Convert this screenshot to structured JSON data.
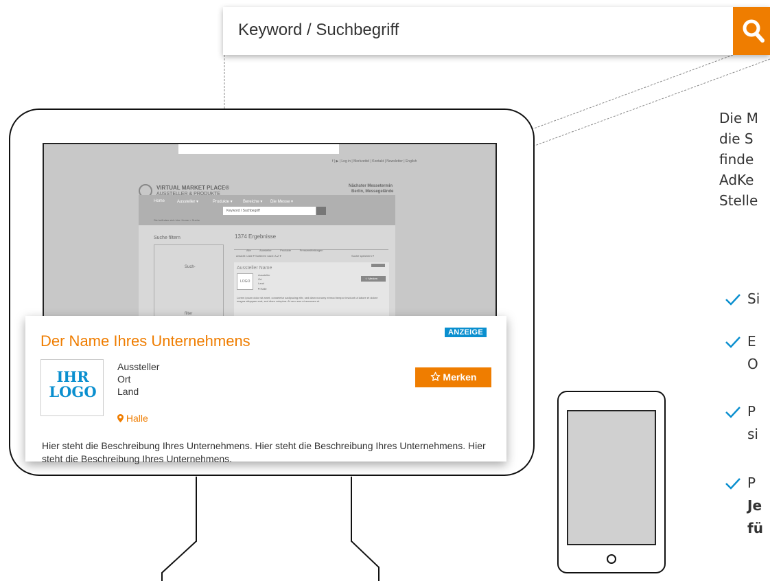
{
  "search": {
    "placeholder": "Keyword / Suchbegriff",
    "icon": "search-icon"
  },
  "mini_site": {
    "title_line1": "VIRTUAL MARKET PLACE®",
    "title_line2": "AUSSTELLER & PRODUKTE",
    "top_links": "f | ▶ | Log in | Merkzettel | Kontakt | Newsletter | English",
    "next_fair": "Nächster Messetermin",
    "next_fair_place": "Berlin, Messegelände",
    "nav": [
      "Home",
      "Aussteller ▾",
      "Produkte ▾",
      "Bereiche ▾",
      "Die Messe ▾"
    ],
    "search_placeholder": "Keyword / Suchbegriff",
    "breadcrumb": "Sie befinden sich hier: Home > Suche",
    "filter_title": "Suche filtern",
    "result_count": "1374 Ergebnisse",
    "tabs": [
      "Alle",
      "Aussteller",
      "Produkte",
      "Pressemitteilungen"
    ],
    "sort": "Ansicht: Liste ▾    Sortieren nach: A-Z ▾",
    "save": "Suche speichern ▾",
    "card_title": "Aussteller Name",
    "card_logo": "LOGO",
    "card_lines": [
      "Aussteller",
      "Ort",
      "Land"
    ],
    "card_merken": "☆ Merken",
    "card_hall": "♥ Halle",
    "card_desc": "Lorem ipsum dolor sit amet, consetetur sadipscing elitr, sed diam nonumy eirmod tempor invidunt ut labore et dolore magna aliquyam erat, sed diam voluptua. At vero eos et accusam et",
    "filter_rows": [
      "Such-",
      "filter"
    ]
  },
  "ad": {
    "company_name": "Der Name Ihres Unternehmens",
    "badge": "ANZEIGE",
    "logo": [
      "IHR",
      "LOGO"
    ],
    "details": [
      "Aussteller",
      "Ort",
      "Land"
    ],
    "hall": "Halle",
    "merken": "Merken",
    "description": "Hier steht die Beschreibung Ihres Unternehmens. Hier steht die Beschreibung Ihres Unternehmens. Hier steht die Beschreibung Ihres Unternehmens."
  },
  "right_text": {
    "lines": [
      "Die M",
      "die S",
      "finde",
      "AdKe",
      "Stelle"
    ],
    "checks": [
      {
        "line1": "Si",
        "line2": ""
      },
      {
        "line1": "E",
        "line2": "O"
      },
      {
        "line1": "P",
        "line2": "si"
      },
      {
        "line1": "P",
        "line2": "Je",
        "line3": "fü"
      }
    ]
  },
  "colors": {
    "accent": "#ef7d00",
    "badge": "#0a8fcf",
    "logo": "#0a8fcf"
  }
}
